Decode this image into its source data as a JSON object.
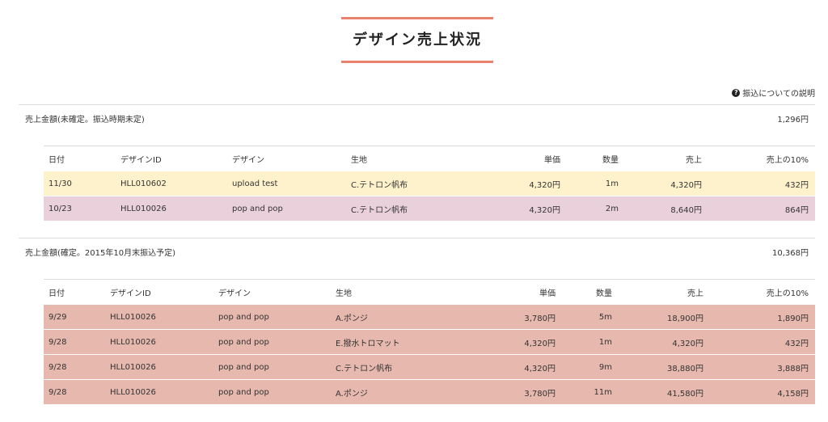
{
  "page": {
    "title": "デザイン売上状況"
  },
  "help": {
    "label": "振込についての説明",
    "icon": "question-circle-icon"
  },
  "columns": [
    "日付",
    "デザインID",
    "デザイン",
    "生地",
    "単価",
    "数量",
    "売上",
    "売上の10%"
  ],
  "unconfirmed": {
    "label": "売上金額(未確定。振込時期未定)",
    "total": "1,296円",
    "rows": [
      {
        "date": "11/30",
        "design_id": "HLL010602",
        "design": "upload test",
        "fabric": "C.テトロン帆布",
        "unit_price": "4,320円",
        "qty": "1m",
        "sales": "4,320円",
        "ten_percent": "432円",
        "color": "yellow"
      },
      {
        "date": "10/23",
        "design_id": "HLL010026",
        "design": "pop and pop",
        "fabric": "C.テトロン帆布",
        "unit_price": "4,320円",
        "qty": "2m",
        "sales": "8,640円",
        "ten_percent": "864円",
        "color": "pink"
      }
    ]
  },
  "confirmed": {
    "label": "売上金額(確定。2015年10月末振込予定)",
    "total": "10,368円",
    "rows": [
      {
        "date": "9/29",
        "design_id": "HLL010026",
        "design": "pop and pop",
        "fabric": "A.ポンジ",
        "unit_price": "3,780円",
        "qty": "5m",
        "sales": "18,900円",
        "ten_percent": "1,890円",
        "color": "salmon"
      },
      {
        "date": "9/28",
        "design_id": "HLL010026",
        "design": "pop and pop",
        "fabric": "E.撥水トロマット",
        "unit_price": "4,320円",
        "qty": "1m",
        "sales": "4,320円",
        "ten_percent": "432円",
        "color": "salmon"
      },
      {
        "date": "9/28",
        "design_id": "HLL010026",
        "design": "pop and pop",
        "fabric": "C.テトロン帆布",
        "unit_price": "4,320円",
        "qty": "9m",
        "sales": "38,880円",
        "ten_percent": "3,888円",
        "color": "salmon"
      },
      {
        "date": "9/28",
        "design_id": "HLL010026",
        "design": "pop and pop",
        "fabric": "A.ポンジ",
        "unit_price": "3,780円",
        "qty": "11m",
        "sales": "41,580円",
        "ten_percent": "4,158円",
        "color": "salmon"
      }
    ]
  },
  "colors": {
    "accent": "#e8826f",
    "row_yellow": "#fef2cc",
    "row_pink": "#e9d0da",
    "row_salmon": "#e6b8ae"
  }
}
